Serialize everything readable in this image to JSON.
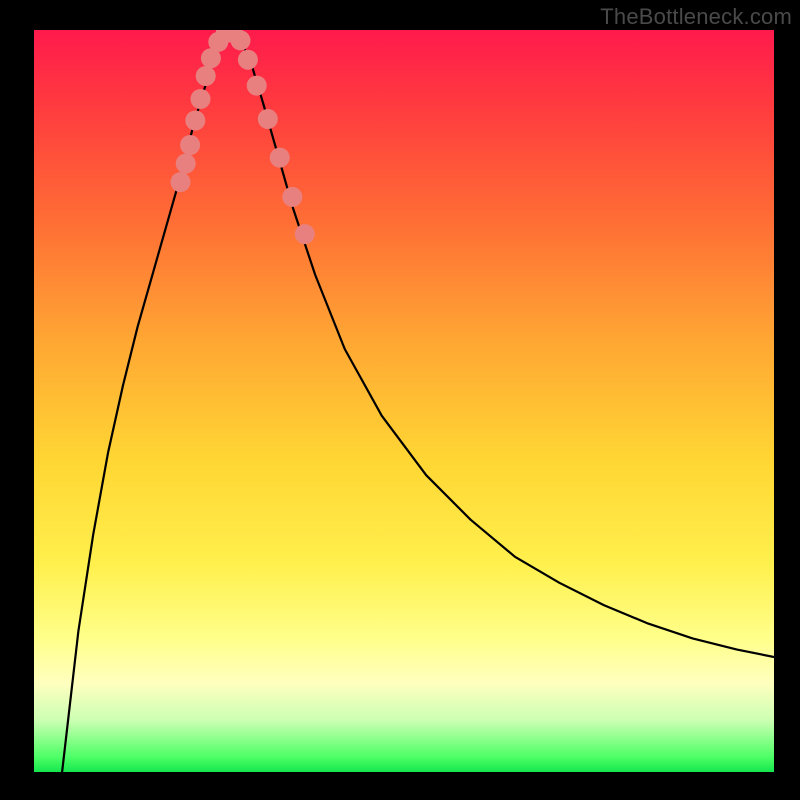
{
  "watermark": {
    "text": "TheBottleneck.com"
  },
  "chart_data": {
    "type": "line",
    "title": "",
    "xlabel": "",
    "ylabel": "",
    "xlim": [
      0,
      1
    ],
    "ylim": [
      0,
      1
    ],
    "series": [
      {
        "name": "curve",
        "x": [
          0.038,
          0.06,
          0.08,
          0.1,
          0.12,
          0.14,
          0.16,
          0.18,
          0.2,
          0.215,
          0.23,
          0.243,
          0.255,
          0.267,
          0.28,
          0.295,
          0.31,
          0.33,
          0.35,
          0.38,
          0.42,
          0.47,
          0.53,
          0.59,
          0.65,
          0.71,
          0.77,
          0.83,
          0.89,
          0.95,
          1.0
        ],
        "y": [
          0.0,
          0.19,
          0.32,
          0.43,
          0.52,
          0.6,
          0.67,
          0.74,
          0.81,
          0.87,
          0.92,
          0.96,
          0.985,
          0.997,
          0.985,
          0.95,
          0.9,
          0.83,
          0.76,
          0.67,
          0.57,
          0.48,
          0.4,
          0.34,
          0.29,
          0.255,
          0.225,
          0.2,
          0.18,
          0.165,
          0.155
        ]
      }
    ],
    "markers": [
      {
        "x": 0.198,
        "y": 0.795
      },
      {
        "x": 0.205,
        "y": 0.82
      },
      {
        "x": 0.211,
        "y": 0.845
      },
      {
        "x": 0.218,
        "y": 0.878
      },
      {
        "x": 0.225,
        "y": 0.907
      },
      {
        "x": 0.232,
        "y": 0.938
      },
      {
        "x": 0.239,
        "y": 0.962
      },
      {
        "x": 0.249,
        "y": 0.984
      },
      {
        "x": 0.259,
        "y": 0.996
      },
      {
        "x": 0.269,
        "y": 0.996
      },
      {
        "x": 0.279,
        "y": 0.986
      },
      {
        "x": 0.289,
        "y": 0.96
      },
      {
        "x": 0.301,
        "y": 0.925
      },
      {
        "x": 0.316,
        "y": 0.88
      },
      {
        "x": 0.332,
        "y": 0.828
      },
      {
        "x": 0.349,
        "y": 0.775
      },
      {
        "x": 0.366,
        "y": 0.725
      }
    ],
    "marker_style": {
      "color": "#e98080",
      "radius_px": 10
    }
  }
}
